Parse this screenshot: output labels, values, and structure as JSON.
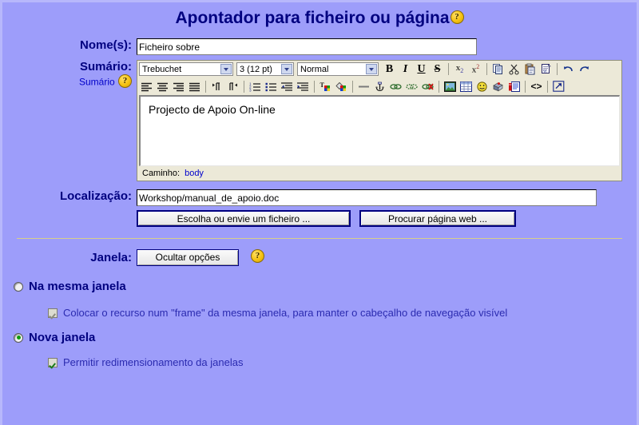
{
  "page": {
    "title": "Apontador para ficheiro ou página",
    "title_help_icon": "help-icon",
    "help_glyph": "?"
  },
  "fields": {
    "name": {
      "label": "Nome(s):",
      "value": "Ficheiro sobre",
      "placeholder": ""
    },
    "summary": {
      "label": "Sumário:",
      "sub_link": "Sumário",
      "help_glyph": "?"
    },
    "location": {
      "label": "Localização:",
      "value": "Workshop/manual_de_apoio.doc",
      "placeholder": ""
    },
    "window": {
      "label": "Janela:",
      "help_glyph": "?"
    }
  },
  "editor": {
    "font_select": {
      "value": "Trebuchet",
      "icon": "chevron-down-icon"
    },
    "size_select": {
      "value": "3 (12 pt)",
      "icon": "chevron-down-icon"
    },
    "style_select": {
      "value": "Normal",
      "icon": "chevron-down-icon"
    },
    "content": "Projecto de Apoio On-line",
    "path_label": "Caminho:",
    "path_value": "body",
    "toolbar_row1": [
      {
        "name": "bold-icon",
        "glyph": "B",
        "style": "bold"
      },
      {
        "name": "italic-icon",
        "glyph": "I",
        "style": "italic"
      },
      {
        "name": "underline-icon",
        "glyph": "U",
        "style": "underline"
      },
      {
        "name": "strikethrough-icon",
        "glyph": "S",
        "style": "strike"
      },
      {
        "name": "separator",
        "glyph": "",
        "style": "sep"
      },
      {
        "name": "subscript-icon",
        "glyph": "x₂",
        "style": "sub"
      },
      {
        "name": "superscript-icon",
        "glyph": "x²",
        "style": "sup"
      },
      {
        "name": "separator",
        "glyph": "",
        "style": "sep"
      },
      {
        "name": "copy-icon",
        "glyph": "",
        "style": "svg-copy"
      },
      {
        "name": "cut-icon",
        "glyph": "",
        "style": "svg-cut"
      },
      {
        "name": "paste-icon",
        "glyph": "",
        "style": "svg-paste"
      },
      {
        "name": "paste-word-icon",
        "glyph": "",
        "style": "svg-pasteword"
      },
      {
        "name": "separator",
        "glyph": "",
        "style": "sep"
      },
      {
        "name": "undo-icon",
        "glyph": "",
        "style": "svg-undo"
      },
      {
        "name": "redo-icon",
        "glyph": "",
        "style": "svg-redo"
      }
    ],
    "toolbar_row2": [
      {
        "name": "align-left-icon",
        "style": "svg-al"
      },
      {
        "name": "align-center-icon",
        "style": "svg-ac"
      },
      {
        "name": "align-right-icon",
        "style": "svg-ar"
      },
      {
        "name": "align-justify-icon",
        "style": "svg-aj"
      },
      {
        "name": "separator",
        "style": "sep"
      },
      {
        "name": "direction-ltr-icon",
        "style": "svg-ltr"
      },
      {
        "name": "direction-rtl-icon",
        "style": "svg-rtl"
      },
      {
        "name": "separator",
        "style": "sep"
      },
      {
        "name": "numbered-list-icon",
        "style": "svg-ol"
      },
      {
        "name": "bulleted-list-icon",
        "style": "svg-ul"
      },
      {
        "name": "outdent-icon",
        "style": "svg-outdent"
      },
      {
        "name": "indent-icon",
        "style": "svg-indent"
      },
      {
        "name": "separator",
        "style": "sep"
      },
      {
        "name": "font-color-icon",
        "style": "svg-fcolor"
      },
      {
        "name": "background-color-icon",
        "style": "svg-bcolor"
      },
      {
        "name": "separator",
        "style": "sep"
      },
      {
        "name": "horizontal-rule-icon",
        "style": "svg-hr"
      },
      {
        "name": "anchor-icon",
        "style": "svg-anchor"
      },
      {
        "name": "insert-link-icon",
        "style": "svg-link"
      },
      {
        "name": "edit-link-icon",
        "style": "svg-link2"
      },
      {
        "name": "unlink-icon",
        "style": "svg-unlink"
      },
      {
        "name": "separator",
        "style": "sep"
      },
      {
        "name": "insert-image-icon",
        "style": "svg-image"
      },
      {
        "name": "insert-table-icon",
        "style": "svg-table"
      },
      {
        "name": "insert-emoticon-icon",
        "style": "svg-smiley"
      },
      {
        "name": "insert-media-icon",
        "style": "svg-media"
      },
      {
        "name": "insert-nonbreaking-icon",
        "style": "svg-nbsp"
      },
      {
        "name": "separator",
        "style": "sep"
      },
      {
        "name": "html-source-icon",
        "style": "svg-source"
      },
      {
        "name": "separator",
        "style": "sep"
      },
      {
        "name": "fullscreen-icon",
        "style": "svg-full"
      }
    ]
  },
  "buttons": {
    "choose_file": "Escolha ou envie um ficheiro ...",
    "search_web": "Procurar página web ...",
    "hide_options": "Ocultar opções"
  },
  "options": {
    "same_window": {
      "label": "Na mesma janela",
      "selected": false,
      "sub": {
        "label": "Colocar o recurso num \"frame\" da mesma janela, para manter o cabeçalho de navegação visível",
        "checked": true,
        "disabled": true
      }
    },
    "new_window": {
      "label": "Nova janela",
      "selected": true,
      "sub": {
        "label": "Permitir redimensionamento da janelas",
        "checked": true,
        "disabled": false
      }
    }
  },
  "colors": {
    "page_background": "#9d9dfa",
    "label_text": "#00007f",
    "link_text": "#0000c8",
    "editor_chrome": "#ece9d8",
    "button_border": "#00007f",
    "divider": "#d8cf8a",
    "radio_selected": "#0d9c0d"
  }
}
